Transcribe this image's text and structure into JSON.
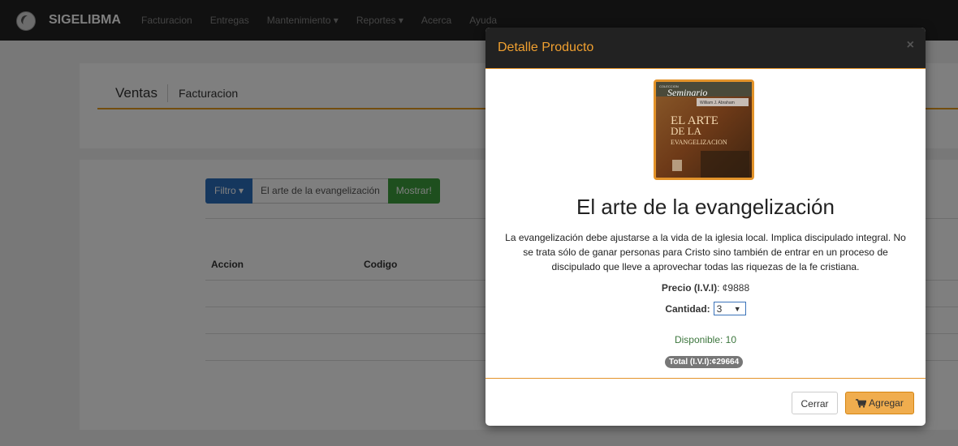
{
  "navbar": {
    "brand": "SIGELIBMA",
    "items": [
      {
        "label": "Facturacion",
        "dropdown": false
      },
      {
        "label": "Entregas",
        "dropdown": false
      },
      {
        "label": "Mantenimiento",
        "dropdown": true
      },
      {
        "label": "Reportes",
        "dropdown": true
      },
      {
        "label": "Acerca",
        "dropdown": false
      },
      {
        "label": "Ayuda",
        "dropdown": false
      }
    ]
  },
  "breadcrumb": {
    "main": "Ventas",
    "sub": "Facturacion"
  },
  "filter": {
    "button_label": "Filtro",
    "search_value": "El arte de la evangelización",
    "show_label": "Mostrar!"
  },
  "table": {
    "headers": [
      "Accion",
      "Codigo"
    ]
  },
  "modal": {
    "title": "Detalle Producto",
    "close_icon": "×",
    "product": {
      "cover_series": "COLECCION",
      "cover_brand": "Seminario",
      "cover_author": "William J. Abraham",
      "cover_line1": "EL ARTE",
      "cover_line2": "DE LA",
      "cover_line3": "EVANGELIZACION",
      "title": "El arte de la evangelización",
      "description": "La evangelización debe ajustarse a la vida de la iglesia local. Implica discipulado integral. No se trata sólo de ganar personas para Cristo sino también de entrar en un proceso de discipulado que lleve a aprovechar todas las riquezas de la fe cristiana.",
      "price_label": "Precio (I.V.I)",
      "price_value": ": ¢9888",
      "qty_label": "Cantidad:",
      "qty_value": "3",
      "available": "Disponible: 10",
      "total": "Total (I.V.I):¢29664"
    },
    "close_button": "Cerrar",
    "add_button": "Agregar"
  },
  "colors": {
    "accent": "#e3932a",
    "navbar": "#222222",
    "add_button": "#f0ad4e",
    "filter_button": "#2a6ebc",
    "show_button": "#3c9e3c"
  },
  "icons": {
    "logo": "logo-icon",
    "cart": "cart-icon"
  }
}
